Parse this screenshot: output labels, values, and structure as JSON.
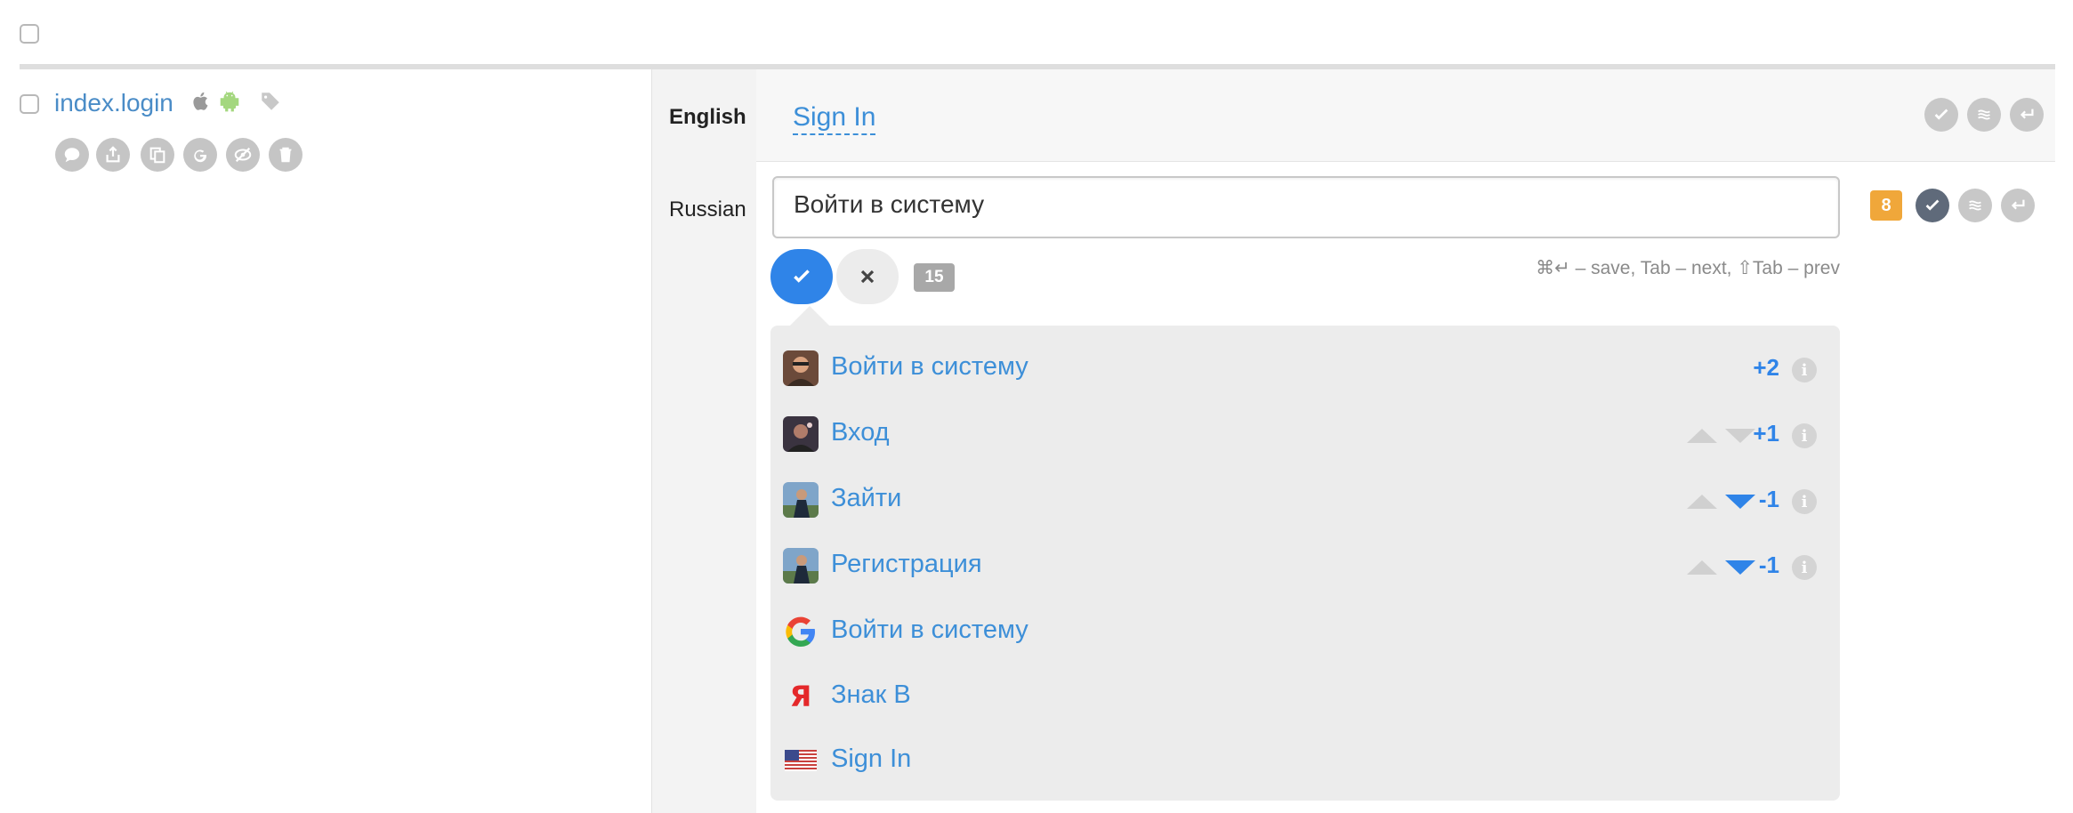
{
  "key": {
    "name": "index.login",
    "platform_icons": [
      "apple-icon",
      "android-icon",
      "tag-icon"
    ],
    "action_icons": [
      "comment-icon",
      "upload-icon",
      "copy-icon",
      "google-icon",
      "hide-icon",
      "trash-icon"
    ]
  },
  "source": {
    "language": "English",
    "text": "Sign In"
  },
  "target": {
    "language": "Russian",
    "value": "Войти в систему",
    "char_count": "15",
    "hint": "⌘↵ – save, Tab – next, ⇧Tab – prev",
    "pending_badge": "8"
  },
  "suggestions": [
    {
      "text": "Войти в систему",
      "score": "+2",
      "source_icon": "user-avatar-1",
      "votes": false
    },
    {
      "text": "Вход",
      "score": "+1",
      "source_icon": "user-avatar-2",
      "votes": true,
      "downvoted": false
    },
    {
      "text": "Зайти",
      "score": "-1",
      "source_icon": "user-avatar-3",
      "votes": true,
      "downvoted": true
    },
    {
      "text": "Регистрация",
      "score": "-1",
      "source_icon": "user-avatar-3",
      "votes": true,
      "downvoted": true
    },
    {
      "text": "Войти в систему",
      "score": "",
      "source_icon": "google-icon",
      "votes": false
    },
    {
      "text": "Знак В",
      "score": "",
      "source_icon": "yandex-icon",
      "votes": false
    },
    {
      "text": "Sign In",
      "score": "",
      "source_icon": "us-flag-icon",
      "votes": false
    }
  ],
  "colors": {
    "accent": "#2f84e8",
    "link": "#3d8fd8",
    "badge_orange": "#f0a73a",
    "android_green": "#a4d77f"
  }
}
